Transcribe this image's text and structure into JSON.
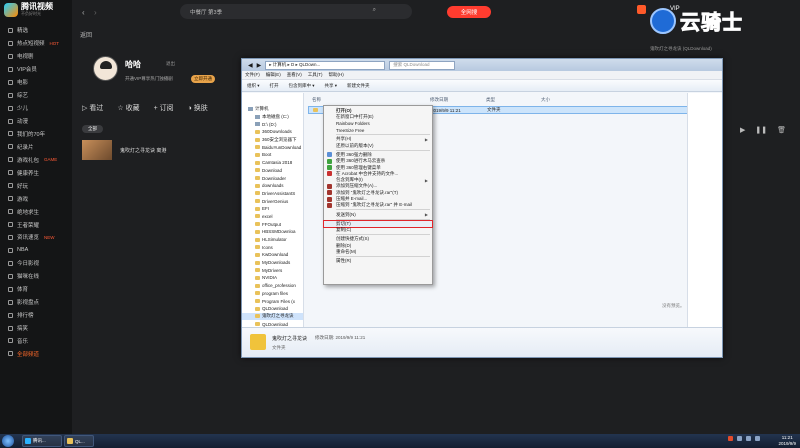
{
  "app": {
    "logo_text": "腾讯视频",
    "logo_sub": "不负好时光",
    "search_query": "中餐厅 第3季",
    "hot_label": "全网搜",
    "vip_label": "VIP"
  },
  "sidebar": {
    "items": [
      {
        "label": "精选",
        "badge": ""
      },
      {
        "label": "热点短视频",
        "badge": "HOT"
      },
      {
        "label": "电视剧",
        "badge": ""
      },
      {
        "label": "VIP会员",
        "badge": ""
      },
      {
        "label": "电影",
        "badge": ""
      },
      {
        "label": "综艺",
        "badge": ""
      },
      {
        "label": "少儿",
        "badge": ""
      },
      {
        "label": "动漫",
        "badge": ""
      },
      {
        "label": "我们的70年",
        "badge": ""
      },
      {
        "label": "纪录片",
        "badge": ""
      },
      {
        "label": "游戏礼包",
        "badge": "GAME"
      },
      {
        "label": "健康养生",
        "badge": ""
      },
      {
        "label": "好玩",
        "badge": ""
      },
      {
        "label": "游戏",
        "badge": ""
      },
      {
        "label": "绝地求生",
        "badge": ""
      },
      {
        "label": "王者荣耀",
        "badge": ""
      },
      {
        "label": "资讯速览",
        "badge": "NEW"
      },
      {
        "label": "NBA",
        "badge": ""
      },
      {
        "label": "今日影视",
        "badge": ""
      },
      {
        "label": "猫咪在线",
        "badge": ""
      },
      {
        "label": "体育",
        "badge": ""
      },
      {
        "label": "影视盘点",
        "badge": ""
      },
      {
        "label": "排行榜",
        "badge": ""
      },
      {
        "label": "搞笑",
        "badge": ""
      },
      {
        "label": "音乐",
        "badge": ""
      },
      {
        "label": "全部频道",
        "badge": ""
      }
    ]
  },
  "profile": {
    "back_label": "返回",
    "username": "哈哈",
    "logout_label": "退出",
    "subtitle": "开通VIP尊享热门独播剧",
    "renew_label": "立即开通"
  },
  "tabs": [
    "看过",
    "收藏",
    "订阅",
    "换肤"
  ],
  "subtabs": [
    "全部"
  ],
  "history": {
    "title": "鬼吹灯之寻龙诀 离港"
  },
  "watermark": {
    "text": "云骑士",
    "subtitle": "鬼吹灯之寻龙诀 (QLDownload)"
  },
  "explorer": {
    "address": "▸ 计算机 ▸ D ▸ QLDown...",
    "search_placeholder": "搜索 QLDownload",
    "menu": [
      "文件(F)",
      "编辑(E)",
      "查看(V)",
      "工具(T)",
      "帮助(H)"
    ],
    "toolbar": [
      "组织 ▾",
      "打开",
      "包含到库中 ▾",
      "共享 ▾",
      "新建文件夹"
    ],
    "columns": [
      "名称",
      "修改日期",
      "类型",
      "大小"
    ],
    "file_date": "2019/9/9 11:21",
    "file_type": "文件夹",
    "tree": [
      {
        "label": "计算机",
        "type": "top"
      },
      {
        "label": "本地磁盘 (C:)",
        "type": "drive"
      },
      {
        "label": "D:\\ (D:)",
        "type": "drive"
      },
      {
        "label": "360Downloads",
        "type": "folder"
      },
      {
        "label": "360安全浏览器下",
        "type": "folder"
      },
      {
        "label": "BaiduYunDownload",
        "type": "folder"
      },
      {
        "label": "Boot",
        "type": "folder"
      },
      {
        "label": "Camtasia 2018",
        "type": "folder"
      },
      {
        "label": "Download",
        "type": "folder"
      },
      {
        "label": "Downloader",
        "type": "folder"
      },
      {
        "label": "downloads",
        "type": "folder"
      },
      {
        "label": "DriverAssistantS",
        "type": "folder"
      },
      {
        "label": "DriverGenius",
        "type": "folder"
      },
      {
        "label": "EFI",
        "type": "folder"
      },
      {
        "label": "excel",
        "type": "folder"
      },
      {
        "label": "FFOutput",
        "type": "folder"
      },
      {
        "label": "HBSSMDownloa",
        "type": "folder"
      },
      {
        "label": "HLSimulator",
        "type": "folder"
      },
      {
        "label": "Icons",
        "type": "folder"
      },
      {
        "label": "KwDownload",
        "type": "folder"
      },
      {
        "label": "MyDownloads",
        "type": "folder"
      },
      {
        "label": "MyDrivers",
        "type": "folder"
      },
      {
        "label": "NVIDIA",
        "type": "folder"
      },
      {
        "label": "office_profession",
        "type": "folder"
      },
      {
        "label": "program files",
        "type": "folder"
      },
      {
        "label": "Program Files (x",
        "type": "folder"
      },
      {
        "label": "QLDownload",
        "type": "folder"
      },
      {
        "label": "鬼吹灯之寻龙诀",
        "type": "folder-selected"
      },
      {
        "label": "QLDownload",
        "type": "folder"
      }
    ],
    "preview_note": "没有预览。",
    "details": {
      "name": "鬼吹灯之寻龙诀",
      "date": "修改日期: 2019/9/9 11:21",
      "type": "文件夹"
    }
  },
  "context_menu": [
    {
      "label": "打开(O)",
      "bold": true
    },
    {
      "label": "在新窗口中打开(E)"
    },
    {
      "label": "Rainbow Folders"
    },
    {
      "label": "TreeSize Free"
    },
    {
      "sep": true
    },
    {
      "label": "共享(H)",
      "arrow": true
    },
    {
      "label": "还原以前的版本(V)"
    },
    {
      "sep": true
    },
    {
      "label": "使用 360强力删除",
      "icon": "#5b8fd6"
    },
    {
      "label": "使用 360进行木马云查杀",
      "icon": "#3fa33f"
    },
    {
      "label": "使用 360管理右键菜单",
      "icon": "#3fa33f"
    },
    {
      "label": "在 Acrobat 中合并支持的文件...",
      "icon": "#c93030"
    },
    {
      "label": "包含到库中(I)",
      "arrow": true
    },
    {
      "label": "添加到压缩文件(A)...",
      "icon": "#a2352e"
    },
    {
      "label": "添加到 \"鬼吹灯之寻龙诀.rar\"(T)",
      "icon": "#a2352e"
    },
    {
      "label": "压缩并 E-mail...",
      "icon": "#a2352e"
    },
    {
      "label": "压缩到 \"鬼吹灯之寻龙诀.rar\" 并 E-mail",
      "icon": "#a2352e"
    },
    {
      "sep": true
    },
    {
      "label": "发送到(N)",
      "arrow": true
    },
    {
      "sep": true
    },
    {
      "label": "剪切(T)",
      "highlight": true
    },
    {
      "label": "复制(C)"
    },
    {
      "sep": true
    },
    {
      "label": "创建快捷方式(S)"
    },
    {
      "label": "删除(D)"
    },
    {
      "label": "重命名(M)"
    },
    {
      "sep": true
    },
    {
      "label": "属性(R)"
    }
  ],
  "taskbar": {
    "apps": [
      "腾讯...",
      "QL..."
    ],
    "time": "11:21",
    "date": "2019/9/9"
  }
}
